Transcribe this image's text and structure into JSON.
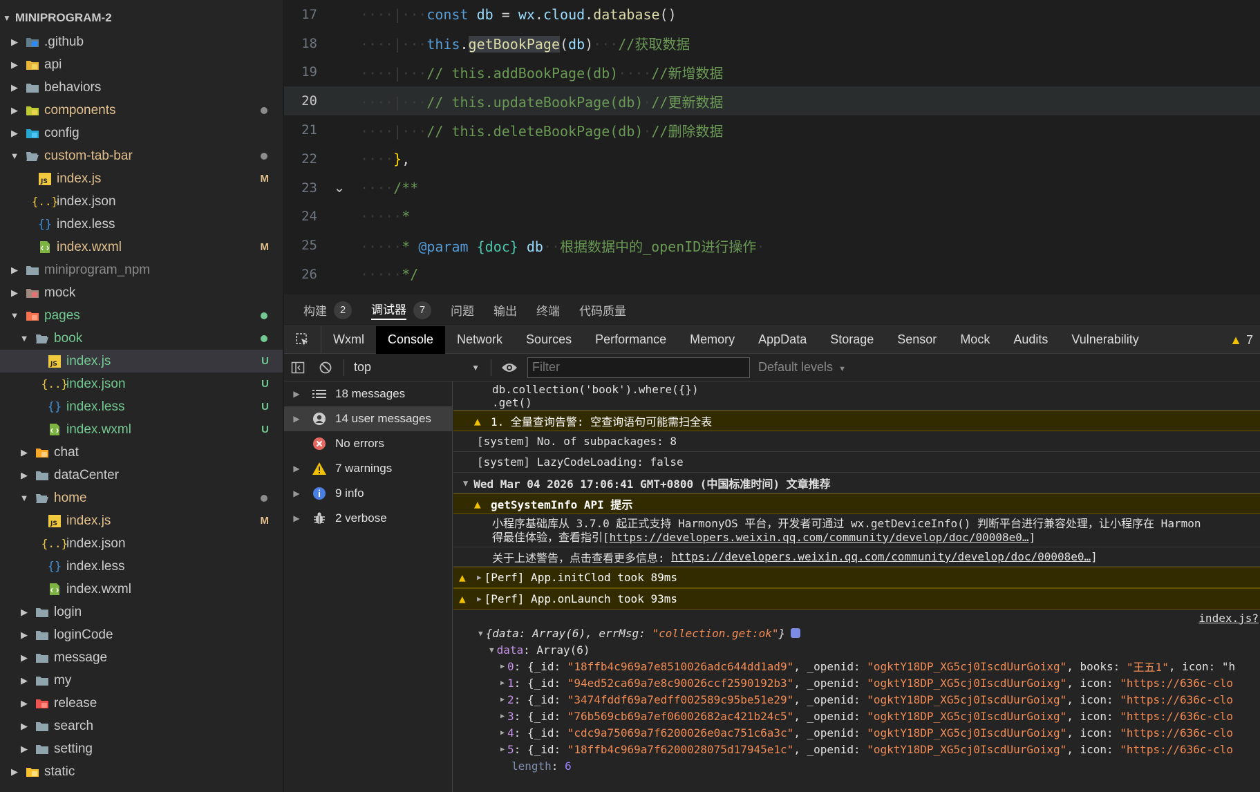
{
  "explorer": {
    "project": "MINIPROGRAM-2",
    "items": [
      {
        "label": ".github",
        "depth": 0,
        "expanded": false,
        "icon": "github-folder-icon",
        "color": "#cccccc",
        "status": "",
        "dot": ""
      },
      {
        "label": "api",
        "depth": 0,
        "expanded": false,
        "icon": "api-folder-icon",
        "color": "#cccccc",
        "status": "",
        "dot": ""
      },
      {
        "label": "behaviors",
        "depth": 0,
        "expanded": false,
        "icon": "folder-icon",
        "color": "#cccccc",
        "status": "",
        "dot": ""
      },
      {
        "label": "components",
        "depth": 0,
        "expanded": false,
        "icon": "components-folder-icon",
        "color": "#e2c08d",
        "status": "",
        "dot": "#8c8c8c"
      },
      {
        "label": "config",
        "depth": 0,
        "expanded": false,
        "icon": "config-folder-icon",
        "color": "#cccccc",
        "status": "",
        "dot": ""
      },
      {
        "label": "custom-tab-bar",
        "depth": 0,
        "expanded": true,
        "icon": "folder-open-icon",
        "color": "#e2c08d",
        "status": "",
        "dot": "#8c8c8c"
      },
      {
        "label": "index.js",
        "depth": 1,
        "expanded": null,
        "icon": "js-file-icon",
        "color": "#e2c08d",
        "status": "M",
        "dot": ""
      },
      {
        "label": "index.json",
        "depth": 1,
        "expanded": null,
        "icon": "json-file-icon",
        "color": "#cccccc",
        "status": "",
        "dot": ""
      },
      {
        "label": "index.less",
        "depth": 1,
        "expanded": null,
        "icon": "less-file-icon",
        "color": "#cccccc",
        "status": "",
        "dot": ""
      },
      {
        "label": "index.wxml",
        "depth": 1,
        "expanded": null,
        "icon": "wxml-file-icon",
        "color": "#e2c08d",
        "status": "M",
        "dot": ""
      },
      {
        "label": "miniprogram_npm",
        "depth": 0,
        "expanded": false,
        "icon": "folder-icon",
        "color": "#8c8c8c",
        "status": "",
        "dot": ""
      },
      {
        "label": "mock",
        "depth": 0,
        "expanded": false,
        "icon": "mock-folder-icon",
        "color": "#cccccc",
        "status": "",
        "dot": ""
      },
      {
        "label": "pages",
        "depth": 0,
        "expanded": true,
        "icon": "pages-folder-icon",
        "color": "#73c991",
        "status": "",
        "dot": "#73c991"
      },
      {
        "label": "book",
        "depth": 1,
        "expanded": true,
        "icon": "folder-open-icon",
        "color": "#73c991",
        "status": "",
        "dot": "#73c991"
      },
      {
        "label": "index.js",
        "depth": 2,
        "expanded": null,
        "icon": "js-file-icon",
        "color": "#73c991",
        "status": "U",
        "dot": "",
        "selected": true
      },
      {
        "label": "index.json",
        "depth": 2,
        "expanded": null,
        "icon": "json-file-icon",
        "color": "#73c991",
        "status": "U",
        "dot": ""
      },
      {
        "label": "index.less",
        "depth": 2,
        "expanded": null,
        "icon": "less-file-icon",
        "color": "#73c991",
        "status": "U",
        "dot": ""
      },
      {
        "label": "index.wxml",
        "depth": 2,
        "expanded": null,
        "icon": "wxml-file-icon",
        "color": "#73c991",
        "status": "U",
        "dot": ""
      },
      {
        "label": "chat",
        "depth": 1,
        "expanded": false,
        "icon": "chat-folder-icon",
        "color": "#cccccc",
        "status": "",
        "dot": ""
      },
      {
        "label": "dataCenter",
        "depth": 1,
        "expanded": false,
        "icon": "folder-icon",
        "color": "#cccccc",
        "status": "",
        "dot": ""
      },
      {
        "label": "home",
        "depth": 1,
        "expanded": true,
        "icon": "folder-open-icon",
        "color": "#e2c08d",
        "status": "",
        "dot": "#8c8c8c"
      },
      {
        "label": "index.js",
        "depth": 2,
        "expanded": null,
        "icon": "js-file-icon",
        "color": "#e2c08d",
        "status": "M",
        "dot": ""
      },
      {
        "label": "index.json",
        "depth": 2,
        "expanded": null,
        "icon": "json-file-icon",
        "color": "#cccccc",
        "status": "",
        "dot": ""
      },
      {
        "label": "index.less",
        "depth": 2,
        "expanded": null,
        "icon": "less-file-icon",
        "color": "#cccccc",
        "status": "",
        "dot": ""
      },
      {
        "label": "index.wxml",
        "depth": 2,
        "expanded": null,
        "icon": "wxml-file-icon",
        "color": "#cccccc",
        "status": "",
        "dot": ""
      },
      {
        "label": "login",
        "depth": 1,
        "expanded": false,
        "icon": "folder-icon",
        "color": "#cccccc",
        "status": "",
        "dot": ""
      },
      {
        "label": "loginCode",
        "depth": 1,
        "expanded": false,
        "icon": "folder-icon",
        "color": "#cccccc",
        "status": "",
        "dot": ""
      },
      {
        "label": "message",
        "depth": 1,
        "expanded": false,
        "icon": "folder-icon",
        "color": "#cccccc",
        "status": "",
        "dot": ""
      },
      {
        "label": "my",
        "depth": 1,
        "expanded": false,
        "icon": "folder-icon",
        "color": "#cccccc",
        "status": "",
        "dot": ""
      },
      {
        "label": "release",
        "depth": 1,
        "expanded": false,
        "icon": "release-folder-icon",
        "color": "#cccccc",
        "status": "",
        "dot": ""
      },
      {
        "label": "search",
        "depth": 1,
        "expanded": false,
        "icon": "folder-icon",
        "color": "#cccccc",
        "status": "",
        "dot": ""
      },
      {
        "label": "setting",
        "depth": 1,
        "expanded": false,
        "icon": "folder-icon",
        "color": "#cccccc",
        "status": "",
        "dot": ""
      },
      {
        "label": "static",
        "depth": 0,
        "expanded": false,
        "icon": "static-folder-icon",
        "color": "#cccccc",
        "status": "",
        "dot": ""
      }
    ]
  },
  "editor": {
    "active_line": "20",
    "lines": [
      {
        "num": "17",
        "indent": "····|···",
        "segments": [
          {
            "t": "const",
            "c": "kw"
          },
          {
            "t": " ",
            "c": "op"
          },
          {
            "t": "db",
            "c": "var"
          },
          {
            "t": " = ",
            "c": "op"
          },
          {
            "t": "wx",
            "c": "var"
          },
          {
            "t": ".",
            "c": "op"
          },
          {
            "t": "cloud",
            "c": "var"
          },
          {
            "t": ".",
            "c": "op"
          },
          {
            "t": "database",
            "c": "fn"
          },
          {
            "t": "()",
            "c": "op"
          }
        ]
      },
      {
        "num": "18",
        "indent": "····|···",
        "segments": [
          {
            "t": "this",
            "c": "kw"
          },
          {
            "t": ".",
            "c": "op"
          },
          {
            "t": "getBookPage",
            "c": "fn-hl"
          },
          {
            "t": "(",
            "c": "op"
          },
          {
            "t": "db",
            "c": "var"
          },
          {
            "t": ")",
            "c": "op"
          },
          {
            "t": "···",
            "c": "dots"
          },
          {
            "t": "//获取数据",
            "c": "cm"
          }
        ]
      },
      {
        "num": "19",
        "indent": "····|···",
        "segments": [
          {
            "t": "// this.addBookPage(db)",
            "c": "cm"
          },
          {
            "t": "····",
            "c": "dots"
          },
          {
            "t": "//新增数据",
            "c": "cm"
          }
        ]
      },
      {
        "num": "20",
        "indent": "····|···",
        "segments": [
          {
            "t": "// this.updateBookPage(db)",
            "c": "cm"
          },
          {
            "t": "·",
            "c": "dots"
          },
          {
            "t": "//更新数据",
            "c": "cm"
          }
        ]
      },
      {
        "num": "21",
        "indent": "····|···",
        "segments": [
          {
            "t": "// this.deleteBookPage(db)",
            "c": "cm"
          },
          {
            "t": "·",
            "c": "dots"
          },
          {
            "t": "//删除数据",
            "c": "cm"
          }
        ]
      },
      {
        "num": "22",
        "indent": "····",
        "segments": [
          {
            "t": "}",
            "c": "br"
          },
          {
            "t": ",",
            "c": "op"
          }
        ]
      },
      {
        "num": "23",
        "indent": "····",
        "fold": "⌄",
        "segments": [
          {
            "t": "/**",
            "c": "cm"
          }
        ]
      },
      {
        "num": "24",
        "indent": "·····",
        "segments": [
          {
            "t": "*",
            "c": "cm"
          }
        ]
      },
      {
        "num": "25",
        "indent": "·····",
        "segments": [
          {
            "t": "* ",
            "c": "cm"
          },
          {
            "t": "@param",
            "c": "tag"
          },
          {
            "t": " ",
            "c": "cm"
          },
          {
            "t": "{doc}",
            "c": "type"
          },
          {
            "t": " ",
            "c": "cm"
          },
          {
            "t": "db",
            "c": "var"
          },
          {
            "t": "··",
            "c": "dots"
          },
          {
            "t": "根据数据中的_openID进行操作",
            "c": "cm"
          },
          {
            "t": "·",
            "c": "dots"
          }
        ]
      },
      {
        "num": "26",
        "indent": "·····",
        "segments": [
          {
            "t": "*/",
            "c": "cm"
          }
        ]
      }
    ]
  },
  "panel": {
    "tabs": [
      {
        "label": "构建",
        "count": "2",
        "active": false
      },
      {
        "label": "调试器",
        "count": "7",
        "active": true
      },
      {
        "label": "问题",
        "count": "",
        "active": false
      },
      {
        "label": "输出",
        "count": "",
        "active": false
      },
      {
        "label": "终端",
        "count": "",
        "active": false
      },
      {
        "label": "代码质量",
        "count": "",
        "active": false
      }
    ]
  },
  "devtools": {
    "tabs": [
      "Wxml",
      "Console",
      "Network",
      "Sources",
      "Performance",
      "Memory",
      "AppData",
      "Storage",
      "Sensor",
      "Mock",
      "Audits",
      "Vulnerability"
    ],
    "active_tab": "Console",
    "warning_count": "7",
    "context": "top",
    "filter_placeholder": "Filter",
    "levels": "Default levels"
  },
  "console_sidebar": [
    {
      "label": "18 messages",
      "icon": "list-icon",
      "arrow": true,
      "active": false
    },
    {
      "label": "14 user messages",
      "icon": "user-icon",
      "arrow": true,
      "active": true
    },
    {
      "label": "No errors",
      "icon": "error-icon",
      "arrow": false,
      "active": false
    },
    {
      "label": "7 warnings",
      "icon": "warning-icon",
      "arrow": true,
      "active": false
    },
    {
      "label": "9 info",
      "icon": "info-icon",
      "arrow": true,
      "active": false
    },
    {
      "label": "2 verbose",
      "icon": "bug-icon",
      "arrow": true,
      "active": false
    }
  ],
  "console_log": {
    "line1": "db.collection('book').where({})",
    "line2": ".get()",
    "warn1": "1. 全量查询告警: 空查询语句可能需扫全表",
    "sys1": "[system] No. of subpackages: 8",
    "sys2": "[system] LazyCodeLoading: false",
    "group_header": "Wed Mar 04 2026 17:06:41 GMT+0800 (中国标准时间) 文章推荐",
    "warn2_title": "getSystemInfo API 提示",
    "warn2_body1": "小程序基础库从 3.7.0 起正式支持 HarmonyOS 平台，开发者可通过 wx.getDeviceInfo() 判断平台进行兼容处理，让小程序在 Harmon",
    "warn2_body2_prefix": "得最佳体验，查看指引[",
    "warn2_link1": "https://developers.weixin.qq.com/community/develop/doc/00008e0…",
    "warn2_body2_suffix": "]",
    "warn2_body3_prefix": "关于上述警告，点击查看更多信息: ",
    "warn2_link2": "https://developers.weixin.qq.com/community/develop/doc/00008e0…",
    "warn2_body3_suffix": "]",
    "perf1": "[Perf] App.initClod took 89ms",
    "perf2": "[Perf] App.onLaunch took 93ms",
    "source_link": "index.js?",
    "obj_header_data": "data",
    "obj_header_array": "Array(6)",
    "obj_header_errmsg": "errMsg",
    "obj_header_errval": "\"collection.get:ok\"",
    "data_label": "data",
    "data_type": "Array(6)",
    "rows": [
      {
        "idx": "0",
        "id": "\"18ffb4c969a7e8510026adc644dd1ad9\"",
        "openid": "\"ogktY18DP_XG5cj0IscdUurGoixg\"",
        "tail_key": "books",
        "tail_val": "\"王五1\"",
        "tail2": ", icon: \"h"
      },
      {
        "idx": "1",
        "id": "\"94ed52ca69a7e8c90026ccf2590192b3\"",
        "openid": "\"ogktY18DP_XG5cj0IscdUurGoixg\"",
        "tail_key": "icon",
        "tail_val": "\"https://636c-clo",
        "tail2": ""
      },
      {
        "idx": "2",
        "id": "\"3474fddf69a7edff002589c95be51e29\"",
        "openid": "\"ogktY18DP_XG5cj0IscdUurGoixg\"",
        "tail_key": "icon",
        "tail_val": "\"https://636c-clo",
        "tail2": ""
      },
      {
        "idx": "3",
        "id": "\"76b569cb69a7ef06002682ac421b24c5\"",
        "openid": "\"ogktY18DP_XG5cj0IscdUurGoixg\"",
        "tail_key": "icon",
        "tail_val": "\"https://636c-clo",
        "tail2": ""
      },
      {
        "idx": "4",
        "id": "\"cdc9a75069a7f6200026e0ac751c6a3c\"",
        "openid": "\"ogktY18DP_XG5cj0IscdUurGoixg\"",
        "tail_key": "icon",
        "tail_val": "\"https://636c-clo",
        "tail2": ""
      },
      {
        "idx": "5",
        "id": "\"18ffb4c969a7f6200028075d17945e1c\"",
        "openid": "\"ogktY18DP_XG5cj0IscdUurGoixg\"",
        "tail_key": "icon",
        "tail_val": "\"https://636c-clo",
        "tail2": ""
      }
    ],
    "length_label": "length",
    "length_value": "6"
  }
}
